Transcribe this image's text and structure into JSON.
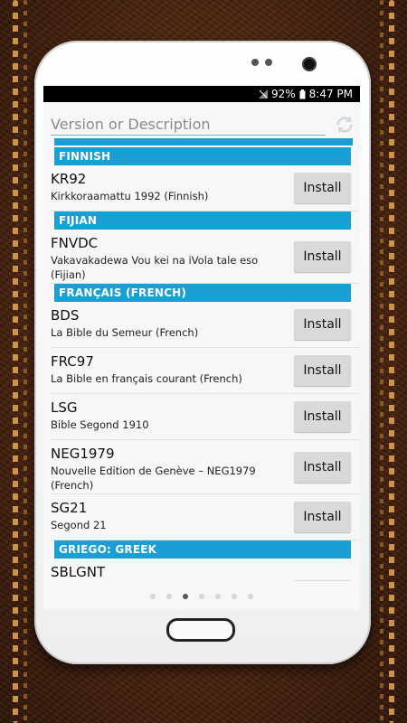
{
  "status": {
    "battery": "92%",
    "time": "8:47 PM"
  },
  "search": {
    "placeholder": "Version or Description"
  },
  "sections": [
    {
      "title": "FINNISH",
      "items": [
        {
          "code": "KR92",
          "desc": "Kirkkoraamattu 1992 (Finnish)",
          "button": "Install"
        }
      ]
    },
    {
      "title": "FIJIAN",
      "items": [
        {
          "code": "FNVDC",
          "desc": "Vakavakadewa Vou kei na iVola tale eso (Fijian)",
          "button": "Install"
        }
      ]
    },
    {
      "title": "FRANÇAIS (FRENCH)",
      "items": [
        {
          "code": "BDS",
          "desc": "La Bible du Semeur (French)",
          "button": "Install"
        },
        {
          "code": "FRC97",
          "desc": "La Bible en français courant (French)",
          "button": "Install"
        },
        {
          "code": "LSG",
          "desc": "Bible Segond 1910",
          "button": "Install"
        },
        {
          "code": "NEG1979",
          "desc": "Nouvelle Edition de Genève – NEG1979 (French)",
          "button": "Install"
        },
        {
          "code": "SG21",
          "desc": "Segond 21",
          "button": "Install"
        }
      ]
    },
    {
      "title": "GRIEGO: GREEK",
      "items": [
        {
          "code": "SBLGNT",
          "desc": "",
          "button": ""
        }
      ]
    }
  ],
  "pager": {
    "count": 7,
    "active_index": 2
  },
  "icons": {
    "refresh": "refresh-icon",
    "signal": "signal-icon",
    "battery": "battery-icon"
  },
  "colors": {
    "section_bg": "#1a9fd4",
    "button_bg": "#d9d9d9"
  }
}
